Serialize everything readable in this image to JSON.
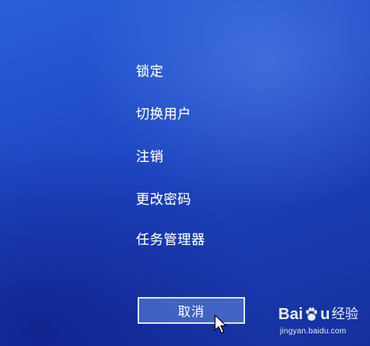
{
  "menu": {
    "items": [
      {
        "label": "锁定"
      },
      {
        "label": "切换用户"
      },
      {
        "label": "注销"
      },
      {
        "label": "更改密码"
      },
      {
        "label": "任务管理器"
      }
    ]
  },
  "cancel_button": {
    "label": "取消"
  },
  "watermark": {
    "brand_left": "Bai",
    "brand_right": "u",
    "brand_suffix": "经验",
    "url": "jingyan.baidu.com"
  },
  "colors": {
    "background": "#1f48c4",
    "text": "#ffffff",
    "button_border": "#ebf0ff"
  },
  "icons": {
    "cursor": "mouse-pointer-icon",
    "paw": "baidu-paw-icon"
  }
}
